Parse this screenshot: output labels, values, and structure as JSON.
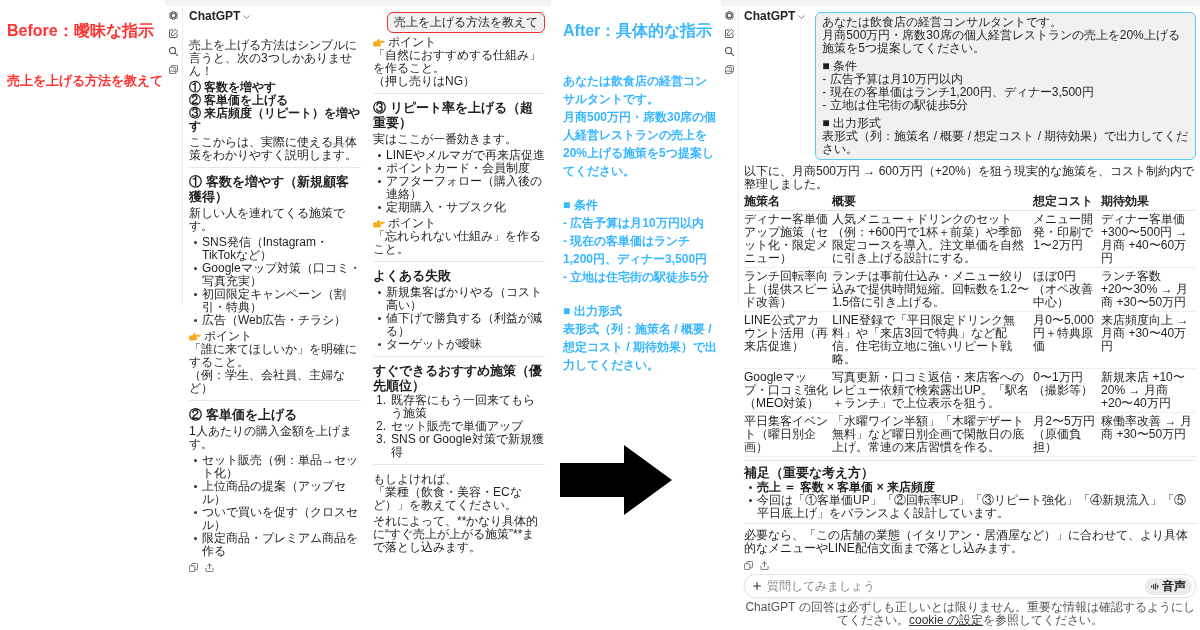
{
  "before": {
    "title": "Before：曖昧な指示",
    "prompt": "売上を上げる方法を教えて"
  },
  "before_chat": {
    "app_name": "ChatGPT",
    "user_message": [
      [
        "売上を上げる方法を教えて"
      ]
    ],
    "reply": [
      {
        "kind": "paragraph",
        "lines": [
          "売上を上げる方法はシンプルに言うと、次の3つしかありません！"
        ]
      },
      {
        "kind": "bold_lines",
        "lines": [
          "① 客数を増やす",
          "② 客単価を上げる",
          "③ 来店頻度（リピート）を増やす"
        ]
      },
      {
        "kind": "paragraph",
        "lines": [
          "ここからは、実際に使える具体策をわかりやすく説明します。"
        ]
      },
      {
        "kind": "divider"
      },
      {
        "kind": "heading",
        "text": "① 客数を増やす（新規顧客獲得）"
      },
      {
        "kind": "paragraph",
        "lines": [
          "新しい人を連れてくる施策です。"
        ]
      },
      {
        "kind": "bullets",
        "items": [
          {
            "text": "SNS発信（Instagram・TikTokなど）",
            "bold": false
          },
          {
            "text": "Googleマップ対策（口コミ・写真充実）",
            "bold": false
          },
          {
            "text": "初回限定キャンペーン（割引・特典）",
            "bold": false
          },
          {
            "text": "広告（Web広告・チラシ）",
            "bold": false
          }
        ]
      },
      {
        "kind": "point",
        "label": "ポイント",
        "lines": [
          "「誰に来てほしいか」を明確にすること。",
          "（例：学生、会社員、主婦など）"
        ]
      },
      {
        "kind": "divider"
      },
      {
        "kind": "heading",
        "text": "② 客単価を上げる"
      },
      {
        "kind": "paragraph",
        "lines": [
          "1人あたりの購入金額を上げます。"
        ]
      },
      {
        "kind": "bullets",
        "items": [
          {
            "text": "セット販売（例：単品→セット化）",
            "bold": false
          },
          {
            "text": "上位商品の提案（アップセル）",
            "bold": false
          },
          {
            "text": "ついで買いを促す（クロスセル）",
            "bold": false
          },
          {
            "text": "限定商品・プレミアム商品を作る",
            "bold": false
          }
        ]
      },
      {
        "kind": "point",
        "label": "ポイント",
        "lines": [
          "「自然におすすめする仕組み」を作ること。",
          "（押し売りはNG）"
        ]
      },
      {
        "kind": "divider"
      },
      {
        "kind": "heading",
        "text": "③ リピート率を上げる（超重要）"
      },
      {
        "kind": "paragraph",
        "lines": [
          "実はここが一番効きます。"
        ]
      },
      {
        "kind": "bullets",
        "items": [
          {
            "text": "LINEやメルマガで再来店促進",
            "bold": false
          },
          {
            "text": "ポイントカード・会員制度",
            "bold": false
          },
          {
            "text": "アフターフォロー（購入後の連絡）",
            "bold": false
          },
          {
            "text": "定期購入・サブスク化",
            "bold": false
          }
        ]
      },
      {
        "kind": "point",
        "label": "ポイント",
        "lines": [
          "「忘れられない仕組み」を作ること。"
        ]
      },
      {
        "kind": "divider"
      },
      {
        "kind": "heading",
        "text": "よくある失敗"
      },
      {
        "kind": "bullets",
        "items": [
          {
            "text": "新規集客ばかりやる（コスト高い）",
            "bold": false
          },
          {
            "text": "値下げで勝負する（利益が減る）",
            "bold": false
          },
          {
            "text": "ターゲットが曖昧",
            "bold": false
          }
        ]
      },
      {
        "kind": "divider"
      },
      {
        "kind": "heading",
        "text": "すぐできるおすすめ施策（優先順位）"
      },
      {
        "kind": "ordered",
        "items": [
          {
            "number": "1.",
            "text": "既存客にもう一回来てもらう施策"
          },
          {
            "number": "2.",
            "text": "セット販売で単価アップ"
          },
          {
            "number": "3.",
            "text": "SNS or Google対策で新規獲得"
          }
        ]
      },
      {
        "kind": "divider"
      },
      {
        "kind": "paragraph",
        "lines": [
          "もしよければ、",
          "「業種（飲食・美容・ECなど）」を教えてください。"
        ]
      },
      {
        "kind": "paragraph",
        "lines": [
          "それによって、**かなり具体的に“すぐ売上が上がる施策”**まで落とし込みます。"
        ]
      }
    ]
  },
  "after": {
    "title": "After：具体的な指示",
    "prompt": [
      [
        "あなたは飲食店の経営コンサルタントです。",
        "月商500万円・席数30席の個人経営レストランの売上を20%上げる施策を5つ提案してください。"
      ],
      [
        "■ 条件",
        "- 広告予算は月10万円以内",
        "- 現在の客単価はランチ1,200円、ディナー3,500円",
        "- 立地は住宅街の駅徒歩5分"
      ],
      [
        "■ 出力形式",
        "表形式（列：施策名 / 概要 / 想定コスト / 期待効果）で出力してください。"
      ]
    ]
  },
  "after_chat": {
    "app_name": "ChatGPT",
    "user_message": [
      [
        "あなたは飲食店の経営コンサルタントです。",
        "月商500万円・席数30席の個人経営レストランの売上を20%上げる施策を5つ提案してください。"
      ],
      [
        "■ 条件",
        "- 広告予算は月10万円以内",
        "- 現在の客単価はランチ1,200円、ディナー3,500円",
        "- 立地は住宅街の駅徒歩5分"
      ],
      [
        "■ 出力形式",
        "表形式（列：施策名 / 概要 / 想定コスト / 期待効果）で出力してください。"
      ]
    ],
    "reply": [
      {
        "kind": "paragraph",
        "lines": [
          "以下に、月商500万円 → 600万円（+20%）を狙う現実的な施策を、コスト制約内で整理しました。"
        ]
      },
      {
        "kind": "table",
        "columns": [
          "施策名",
          "概要",
          "想定コスト",
          "期待効果"
        ],
        "rows": [
          [
            "ディナー客単価アップ施策（セット化・限定メニュー）",
            "人気メニュー＋ドリンクのセット（例：+600円で1杯＋前菜）や季節限定コースを導入。注文単価を自然に引き上げる設計にする。",
            "メニュー開発・印刷で1〜2万円",
            "ディナー客単価 +300〜500円 → 月商 +40〜60万円"
          ],
          [
            "ランチ回転率向上（提供スピード改善）",
            "ランチは事前仕込み・メニュー絞り込みで提供時間短縮。回転数を1.2〜1.5倍に引き上げる。",
            "ほぼ0円（オペ改善中心）",
            "ランチ客数 +20〜30% → 月商 +30〜50万円"
          ],
          [
            "LINE公式アカウント活用（再来店促進）",
            "LINE登録で「平日限定ドリンク無料」や「来店3回で特典」など配信。住宅街立地に強いリピート戦略。",
            "月0〜5,000円＋特典原価",
            "来店頻度向上 → 月商 +30〜40万円"
          ],
          [
            "Googleマップ・口コミ強化（MEO対策）",
            "写真更新・口コミ返信・来店客へのレビュー依頼で検索露出UP。「駅名＋ランチ」で上位表示を狙う。",
            "0〜1万円（撮影等）",
            "新規来店 +10〜20% → 月商 +20〜40万円"
          ],
          [
            "平日集客イベント（曜日別企画）",
            "「水曜ワイン半額」「木曜デザート無料」など曜日別企画で閑散日の底上げ。常連の来店習慣を作る。",
            "月2〜5万円（原価負担）",
            "稼働率改善 → 月商 +30〜50万円"
          ]
        ]
      },
      {
        "kind": "divider"
      },
      {
        "kind": "heading",
        "text": "補足（重要な考え方）"
      },
      {
        "kind": "bullets",
        "items": [
          {
            "text": "売上 ＝ 客数 × 客単価 × 来店頻度",
            "bold": true
          },
          {
            "text": "今回は「①客単価UP」「②回転率UP」「③リピート強化」「④新規流入」「⑤平日底上げ」をバランスよく設計しています。",
            "bold": false
          }
        ]
      },
      {
        "kind": "divider"
      },
      {
        "kind": "paragraph",
        "lines": [
          "必要なら、「この店舗の業態（イタリアン・居酒屋など）」に合わせて、より具体的なメニューやLINE配信文面まで落とし込みます。"
        ]
      }
    ],
    "composer": {
      "placeholder": "質問してみましょう",
      "voice_button": "音声"
    },
    "disclaimer": {
      "text": "ChatGPT の回答は必ずしも正しいとは限りません。重要な情報は確認するようにしてください。",
      "link": "cookie の設定",
      "after_link": "を参照してください。"
    }
  }
}
